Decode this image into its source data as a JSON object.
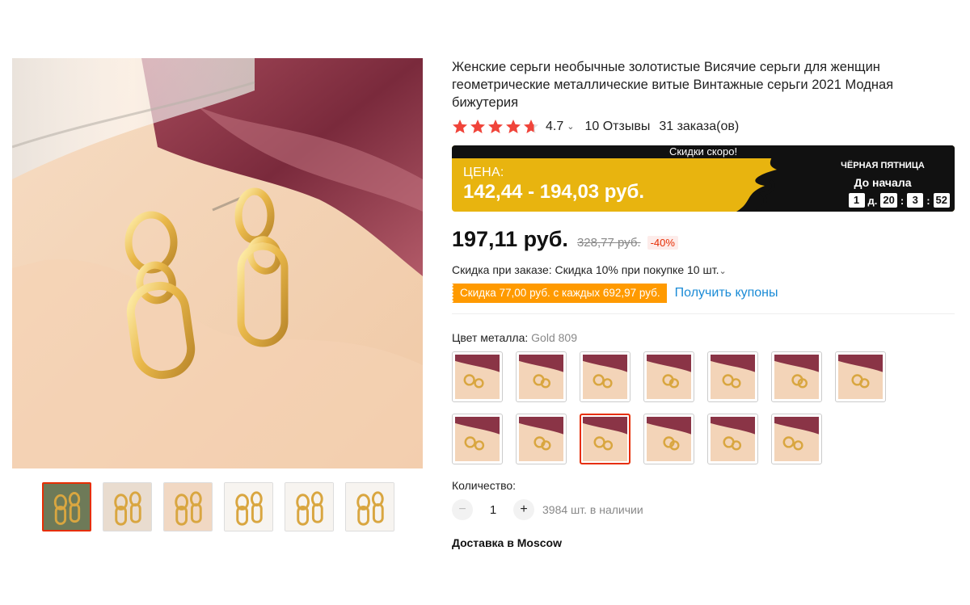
{
  "product": {
    "title": "Женские серьги необычные золотистые Висячие серьги для женщин геометрические металлические витые Винтажные серьги 2021 Модная бижутерия",
    "rating": "4.7",
    "rating_stars": 4.7,
    "reviews": "10 Отзывы",
    "orders": "31 заказа(ов)"
  },
  "promo": {
    "top_label": "Скидки скоро!",
    "price_label": "ЦЕНА:",
    "price_range": "142,44 - 194,03 руб.",
    "event_title": "ЧЁРНАЯ ПЯТНИЦА",
    "event_subtitle": "До начала",
    "countdown": {
      "days": "1",
      "days_unit": "д.",
      "hours": "20",
      "minutes": "3",
      "seconds": "52"
    }
  },
  "price": {
    "current": "197,11 руб.",
    "old": "328,77 руб.",
    "discount": "-40%"
  },
  "bulk_discount": "Скидка при заказе: Скидка 10% при покупке 10 шт.",
  "coupon": {
    "tag": "Скидка 77,00 руб. с каждых 692,97 руб.",
    "link": "Получить купоны"
  },
  "color": {
    "label": "Цвет металла:",
    "selected": "Gold 809",
    "variant_count": 13,
    "selected_index": 9
  },
  "quantity": {
    "label": "Количество:",
    "minus": "−",
    "value": "1",
    "plus": "+",
    "stock": "3984 шт. в наличии"
  },
  "delivery": "Доставка в Moscow",
  "gallery": {
    "thumb_count": 6,
    "active_index": 0
  },
  "colors": {
    "accent": "#e62e04",
    "star": "#f0443a",
    "promo_yellow": "#e8b40f",
    "coupon_orange": "#ff9a00",
    "link_blue": "#1a8bd6"
  }
}
